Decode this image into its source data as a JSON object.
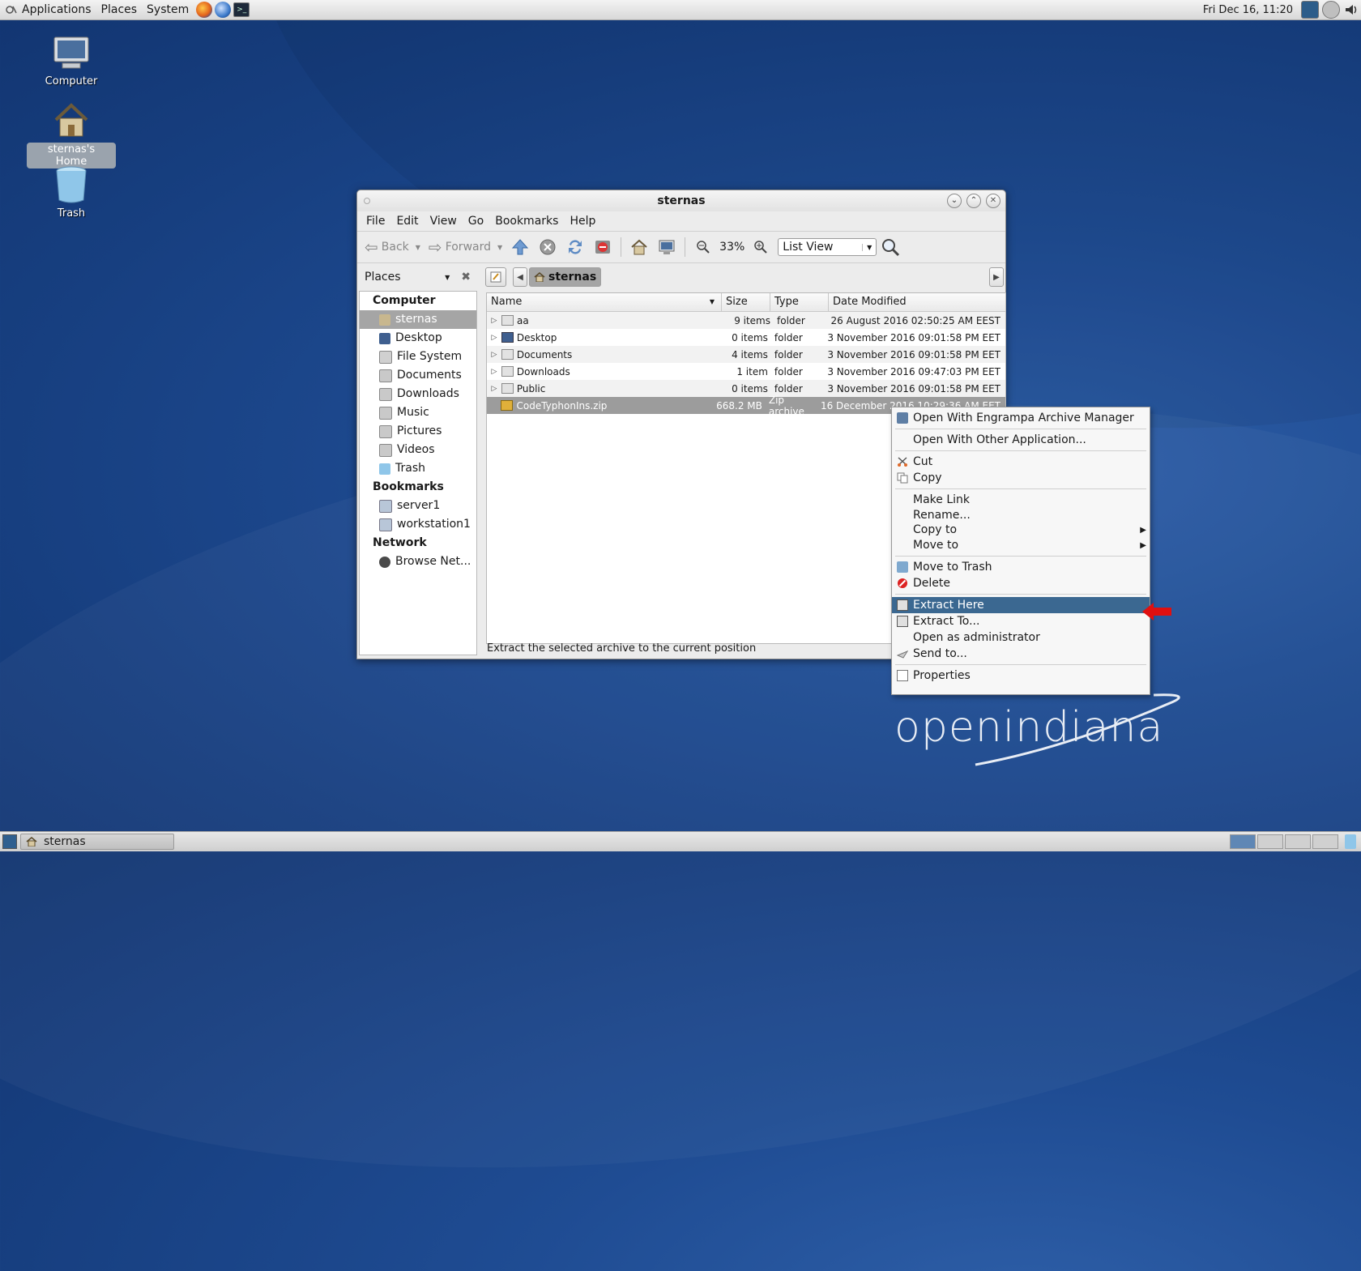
{
  "top_panel": {
    "menus": [
      "Applications",
      "Places",
      "System"
    ],
    "clock": "Fri Dec 16, 11:20"
  },
  "desktop": {
    "icons": [
      {
        "label": "Computer"
      },
      {
        "label": "sternas's Home"
      },
      {
        "label": "Trash"
      }
    ],
    "brand": "openindiana"
  },
  "window": {
    "title": "sternas",
    "menubar": [
      "File",
      "Edit",
      "View",
      "Go",
      "Bookmarks",
      "Help"
    ],
    "toolbar": {
      "back": "Back",
      "forward": "Forward",
      "zoom": "33%",
      "view_mode": "List View"
    },
    "sidebar": {
      "header": "Places",
      "categories": {
        "computer": "Computer",
        "bookmarks": "Bookmarks",
        "network": "Network"
      },
      "computer_items": [
        "sternas",
        "Desktop",
        "File System",
        "Documents",
        "Downloads",
        "Music",
        "Pictures",
        "Videos",
        "Trash"
      ],
      "bookmark_items": [
        "server1",
        "workstation1"
      ],
      "network_items": [
        "Browse Net..."
      ]
    },
    "path": {
      "crumb": "sternas"
    },
    "columns": {
      "name": "Name",
      "size": "Size",
      "type": "Type",
      "date": "Date Modified"
    },
    "files": [
      {
        "name": "aa",
        "size": "9 items",
        "type": "folder",
        "date": "26 August 2016 02:50:25 AM EEST"
      },
      {
        "name": "Desktop",
        "size": "0 items",
        "type": "folder",
        "date": "3 November 2016 09:01:58 PM EET"
      },
      {
        "name": "Documents",
        "size": "4 items",
        "type": "folder",
        "date": "3 November 2016 09:01:58 PM EET"
      },
      {
        "name": "Downloads",
        "size": "1 item",
        "type": "folder",
        "date": "3 November 2016 09:47:03 PM EET"
      },
      {
        "name": "Public",
        "size": "0 items",
        "type": "folder",
        "date": "3 November 2016 09:01:58 PM EET"
      },
      {
        "name": "CodeTyphonIns.zip",
        "size": "668.2 MB",
        "type": "Zip archive",
        "date": "16 December 2016 10:29:36 AM EET"
      }
    ],
    "status": "Extract the selected archive to the current position"
  },
  "context_menu": {
    "open_with_engrampa": "Open With Engrampa Archive Manager",
    "open_with_other": "Open With Other Application...",
    "cut": "Cut",
    "copy": "Copy",
    "make_link": "Make Link",
    "rename": "Rename...",
    "copy_to": "Copy to",
    "move_to": "Move to",
    "move_to_trash": "Move to Trash",
    "delete": "Delete",
    "extract_here": "Extract Here",
    "extract_to": "Extract To...",
    "open_as_admin": "Open as administrator",
    "send_to": "Send to...",
    "properties": "Properties"
  },
  "taskbar": {
    "task_label": "sternas"
  },
  "colors": {
    "desktop_bg": "#1f4c93",
    "menu_highlight": "#3b6891",
    "selection_gray": "#9c9c9c",
    "arrow_red": "#e01010"
  }
}
